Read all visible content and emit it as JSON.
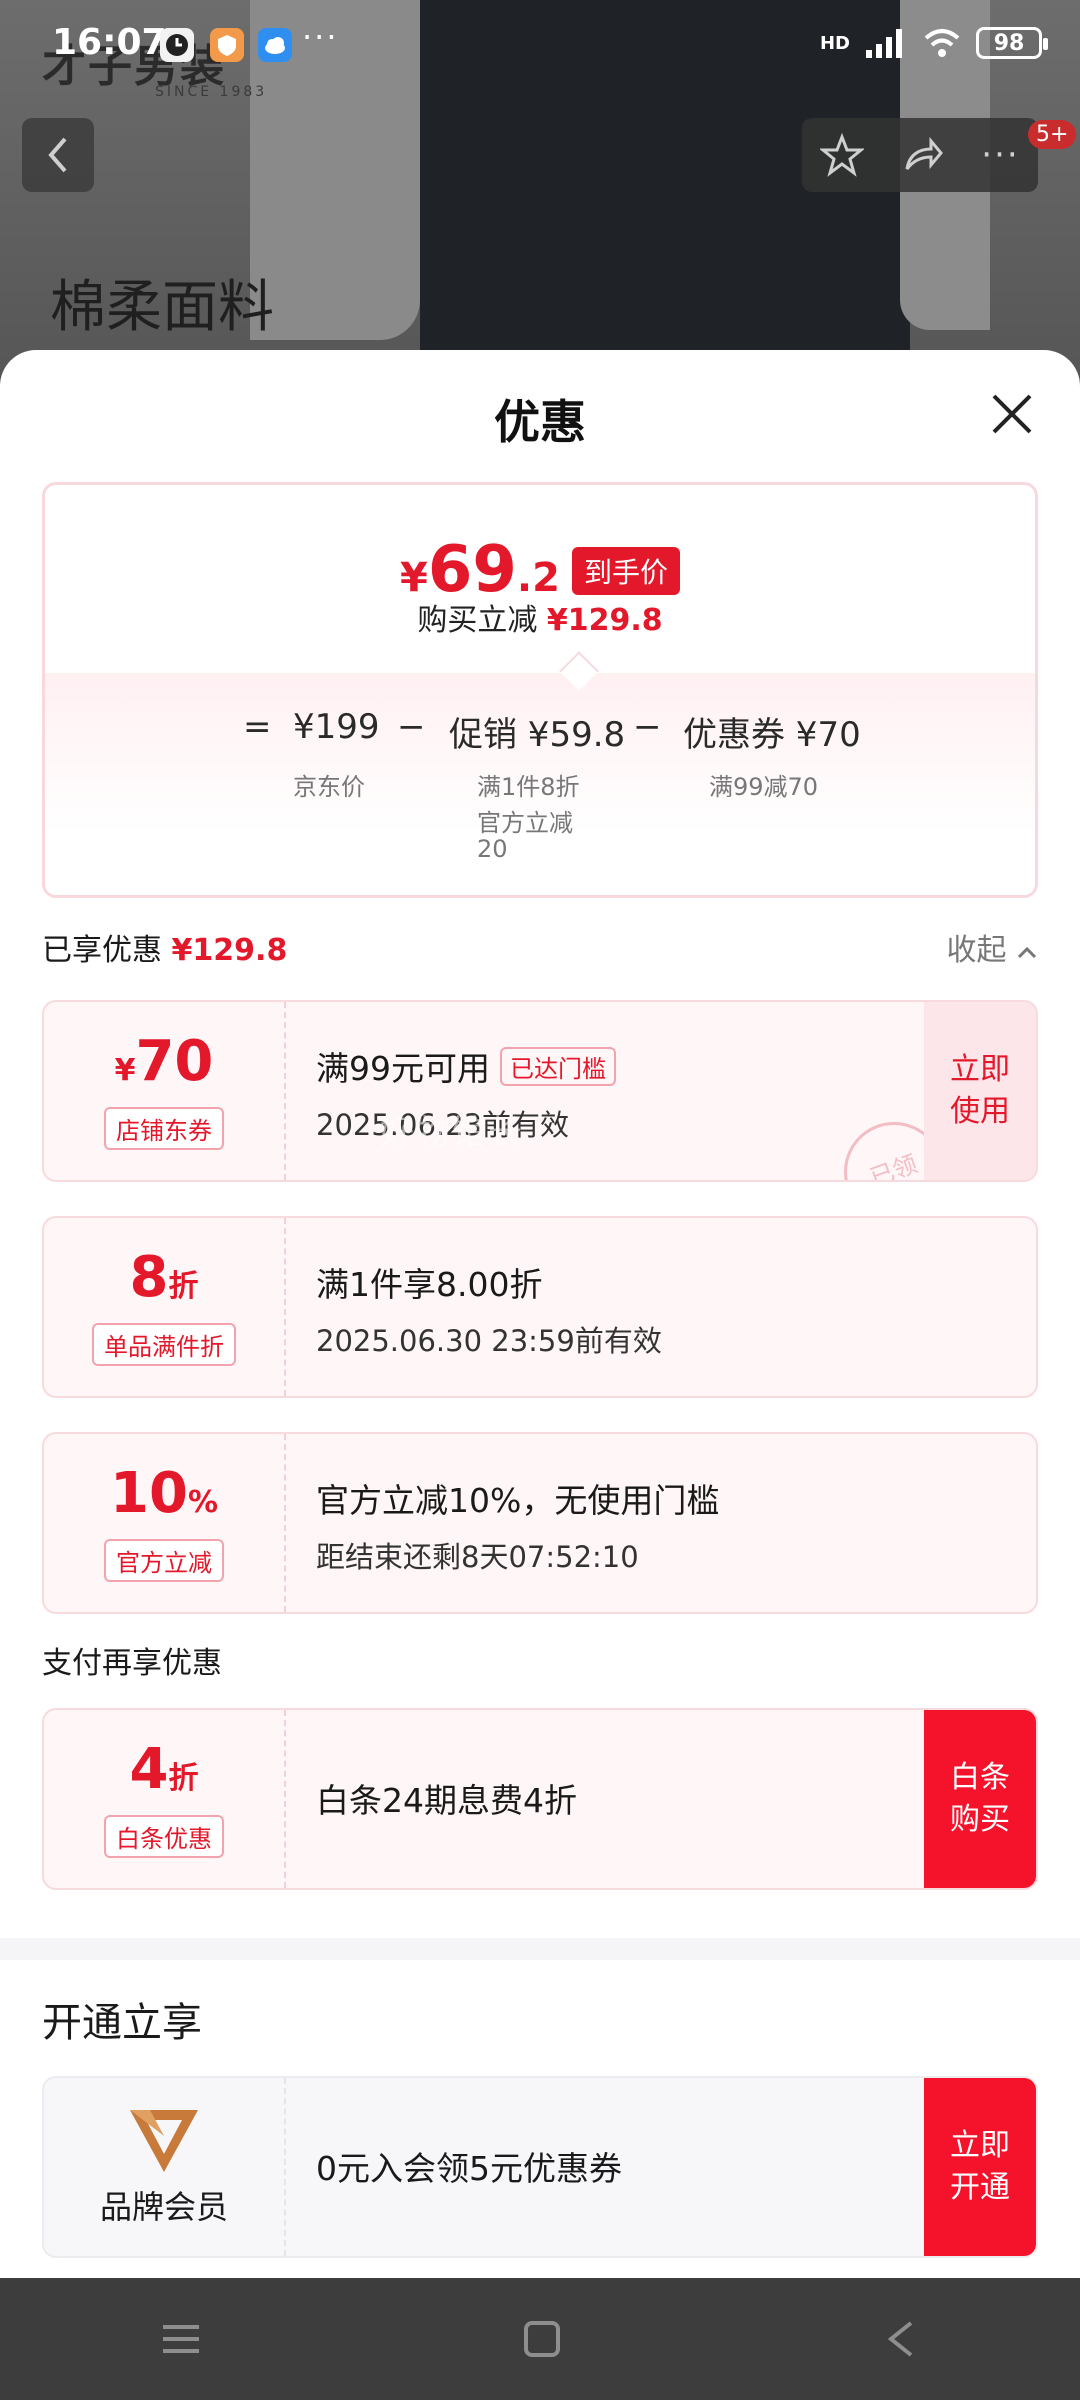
{
  "status_bar": {
    "time": "16:07",
    "dots": "···",
    "network": "HD",
    "battery": "98",
    "icons": [
      "clock-app-icon",
      "shield-app-icon",
      "cloud-app-icon",
      "signal-icon",
      "wifi-icon"
    ]
  },
  "background_page": {
    "brand": "才子男装",
    "brand_since": "SINCE 1983",
    "headline": "棉柔面料",
    "badge": "5+"
  },
  "sheet": {
    "title": "优惠",
    "summary": {
      "price_currency": "¥",
      "price_int": "69",
      "price_dec": ".2",
      "price_tag": "到手价",
      "reduce_label": "购买立减",
      "reduce_value": "¥129.8",
      "eq": "=",
      "minus": "−",
      "jd_price": "¥199",
      "jd_label": "京东价",
      "promo": "促销 ¥59.8",
      "promo_sub1": "满1件8折",
      "promo_sub2": "官方立减",
      "promo_sub3": "20",
      "coupon": "优惠券 ¥70",
      "coupon_sub": "满99减70"
    },
    "enjoyed_label": "已享优惠",
    "enjoyed_value": "¥129.8",
    "collapse_label": "收起",
    "cards": [
      {
        "amount_prefix": "¥",
        "amount": "70",
        "type": "店铺东券",
        "line1": "满99元可用",
        "line1_tag": "已达门槛",
        "line2": "2025.06.23前有效",
        "action": "立即使用",
        "stamp": "已领"
      },
      {
        "amount": "8",
        "amount_suffix": "折",
        "type": "单品满件折",
        "line1": "满1件享8.00折",
        "line2": "2025.06.30 23:59前有效"
      },
      {
        "amount": "10",
        "amount_suffix": "%",
        "type": "官方立减",
        "line1": "官方立减10%，无使用门槛",
        "line2": "距结束还剩8天07:52:10"
      }
    ],
    "watermark": "好物馆长",
    "pay_section_label": "支付再享优惠",
    "pay_card": {
      "amount": "4",
      "amount_suffix": "折",
      "type": "白条优惠",
      "line1": "白条24期息费4折",
      "action": "白条购买"
    },
    "member_section_label": "开通立享",
    "member_card": {
      "name": "品牌会员",
      "line1": "0元入会领5元优惠券",
      "action": "立即开通"
    }
  },
  "colors": {
    "accent": "#e3182b",
    "action_solid": "#f5132c",
    "card_bg": "#fff6f7"
  },
  "nav": [
    "menu-icon",
    "home-square-icon",
    "back-triangle-icon"
  ]
}
